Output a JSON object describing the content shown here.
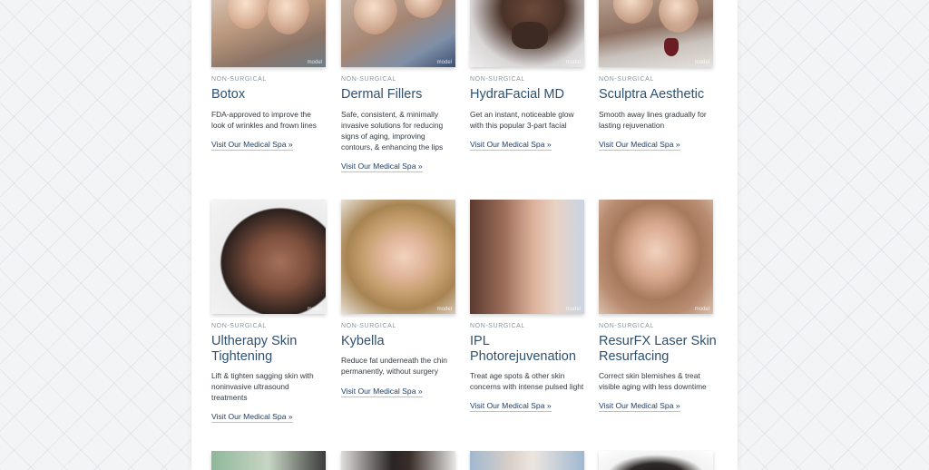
{
  "link_label": "Visit Our Medical Spa »",
  "watermark": "model",
  "rows": [
    [
      {
        "category": "NON-SURGICAL",
        "title": "Botox",
        "description": "FDA-approved to improve the look of wrinkles and frown lines"
      },
      {
        "category": "NON-SURGICAL",
        "title": "Dermal Fillers",
        "description": "Safe, consistent, & minimally invasive solutions for reducing signs of aging, improving contours, & enhancing the lips"
      },
      {
        "category": "NON-SURGICAL",
        "title": "HydraFacial MD",
        "description": "Get an instant, noticeable glow with this popular 3-part facial"
      },
      {
        "category": "NON-SURGICAL",
        "title": "Sculptra Aesthetic",
        "description": "Smooth away lines gradually for lasting rejuvenation"
      }
    ],
    [
      {
        "category": "NON-SURGICAL",
        "title": "Ultherapy Skin Tightening",
        "description": "Lift & tighten sagging skin with noninvasive ultrasound treatments"
      },
      {
        "category": "NON-SURGICAL",
        "title": "Kybella",
        "description": "Reduce fat underneath the chin permanently, without surgery"
      },
      {
        "category": "NON-SURGICAL",
        "title": "IPL Photorejuvenation",
        "description": "Treat age spots & other skin concerns with intense pulsed light"
      },
      {
        "category": "NON-SURGICAL",
        "title": "ResurFX Laser Skin Resurfacing",
        "description": "Correct skin blemishes & treat visible aging with less downtime"
      }
    ]
  ]
}
